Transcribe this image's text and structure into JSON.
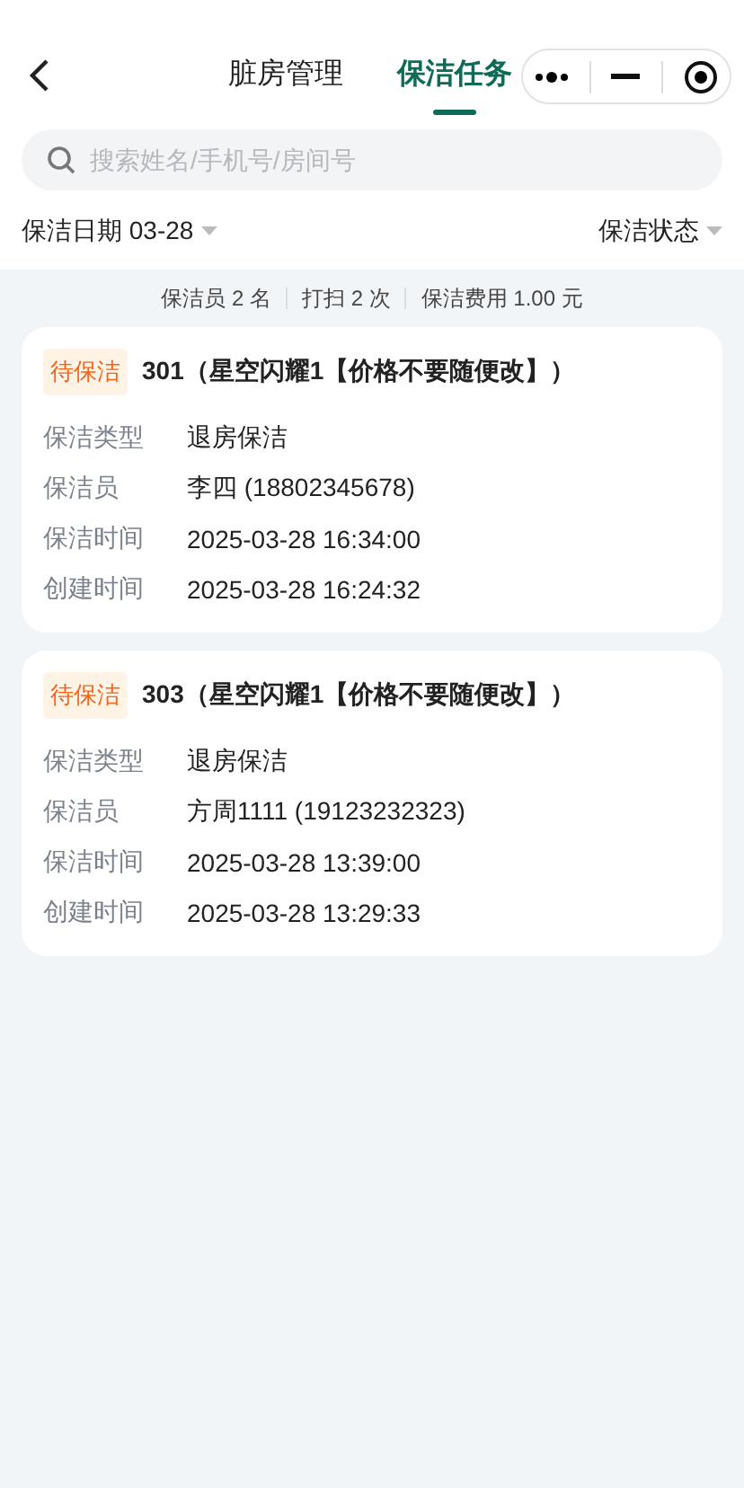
{
  "tabs": [
    {
      "label": "脏房管理",
      "selected": false
    },
    {
      "label": "保洁任务",
      "selected": true
    }
  ],
  "search": {
    "placeholder": "搜索姓名/手机号/房间号"
  },
  "filters": {
    "date": "保洁日期 03-28",
    "status": "保洁状态"
  },
  "summary": [
    "保洁员 2 名",
    "打扫 2 次",
    "保洁费用 1.00 元"
  ],
  "tasks": [
    {
      "badge": "待保洁",
      "title": "301（星空闪耀1【价格不要随便改】）",
      "fields": [
        {
          "label": "保洁类型",
          "value": "退房保洁"
        },
        {
          "label": "保洁员",
          "value": "李四 (18802345678)"
        },
        {
          "label": "保洁时间",
          "value": "2025-03-28 16:34:00"
        },
        {
          "label": "创建时间",
          "value": "2025-03-28 16:24:32"
        }
      ]
    },
    {
      "badge": "待保洁",
      "title": "303（星空闪耀1【价格不要随便改】）",
      "fields": [
        {
          "label": "保洁类型",
          "value": "退房保洁"
        },
        {
          "label": "保洁员",
          "value": "方周1111 (19123232323)"
        },
        {
          "label": "保洁时间",
          "value": "2025-03-28 13:39:00"
        },
        {
          "label": "创建时间",
          "value": "2025-03-28 13:29:33"
        }
      ]
    }
  ]
}
